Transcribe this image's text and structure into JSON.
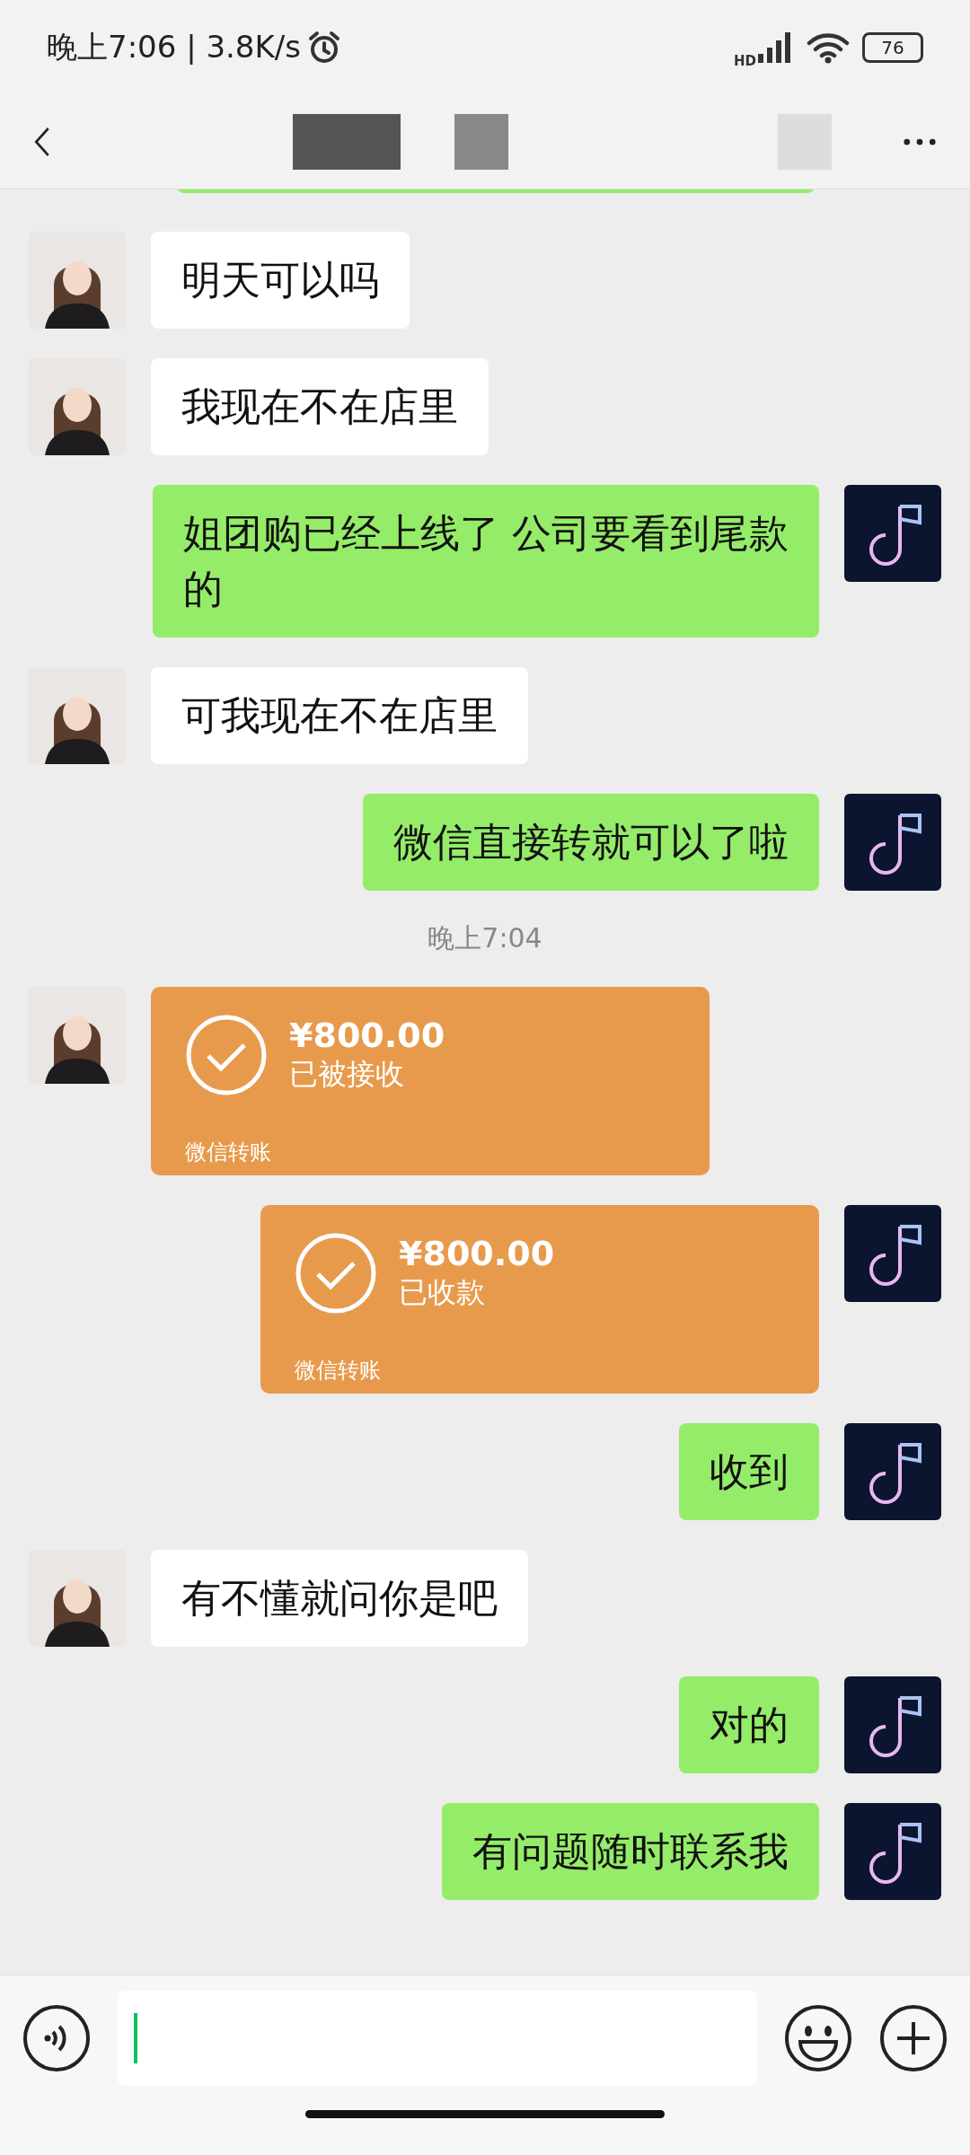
{
  "status_bar": {
    "time": "晚上7:06 | 3.8K/s",
    "network": "HD",
    "battery": "76"
  },
  "messages": [
    {
      "kind": "partial",
      "from_me": true
    },
    {
      "kind": "text",
      "from_me": false,
      "text": "明天可以吗"
    },
    {
      "kind": "text",
      "from_me": false,
      "text": "我现在不在店里"
    },
    {
      "kind": "text",
      "from_me": true,
      "text": "姐团购已经上线了 公司要看到尾款的"
    },
    {
      "kind": "text",
      "from_me": false,
      "text": "可我现在不在店里"
    },
    {
      "kind": "text",
      "from_me": true,
      "text": "微信直接转就可以了啦"
    },
    {
      "kind": "time",
      "text": "晚上7:04"
    },
    {
      "kind": "transfer",
      "from_me": false,
      "amount": "¥800.00",
      "status": "已被接收",
      "label": "微信转账"
    },
    {
      "kind": "transfer",
      "from_me": true,
      "amount": "¥800.00",
      "status": "已收款",
      "label": "微信转账"
    },
    {
      "kind": "text",
      "from_me": true,
      "text": "收到"
    },
    {
      "kind": "text",
      "from_me": false,
      "text": "有不懂就问你是吧"
    },
    {
      "kind": "text",
      "from_me": true,
      "text": "对的"
    },
    {
      "kind": "text",
      "from_me": true,
      "text": "有问题随时联系我"
    }
  ]
}
